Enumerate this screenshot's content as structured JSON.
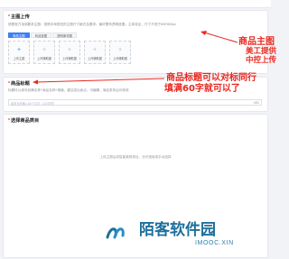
{
  "main_image_section": {
    "required_mark": "*",
    "title": "主图上传",
    "description": "按照官方电商要求主图：按照手淘规范的主图尺寸格式及要求。最好要有透明底图。主体突出，尺寸不低于800*800px",
    "tabs": [
      "商品主图",
      "商品竖图",
      "透明素材图"
    ],
    "slots": [
      {
        "label": "上传主图"
      },
      {
        "label": "上传辅助图"
      },
      {
        "label": "上传辅助图"
      },
      {
        "label": "上传辅助图"
      },
      {
        "label": "上传辅助图"
      }
    ]
  },
  "title_section": {
    "required_mark": "*",
    "title": "商品标题",
    "description": "标题可以填写品牌名称+商品名称+规格，建议突出卖点，可编辑，商品发布后可修改",
    "input_placeholder": "最多允许输入60个汉字（120字符）",
    "char_count": "0/60"
  },
  "category_section": {
    "required_mark": "*",
    "title": "选择商品类目",
    "empty_hint": "上传主图后将智能推荐类目，也可搜索或手动选择"
  },
  "annotations": {
    "main_image_title": "商品主图",
    "main_image_line2": "美工提供",
    "main_image_line3": "中控上传",
    "title_line1": "商品标题可以对标同行",
    "title_line2": "填满60字就可以了"
  },
  "watermark": {
    "name": "陌客软件园",
    "url": "IMOOC.XIN"
  },
  "colors": {
    "accent": "#3d7ff5",
    "annotation_red": "#e8281f",
    "watermark_blue": "#1d6f9b"
  }
}
